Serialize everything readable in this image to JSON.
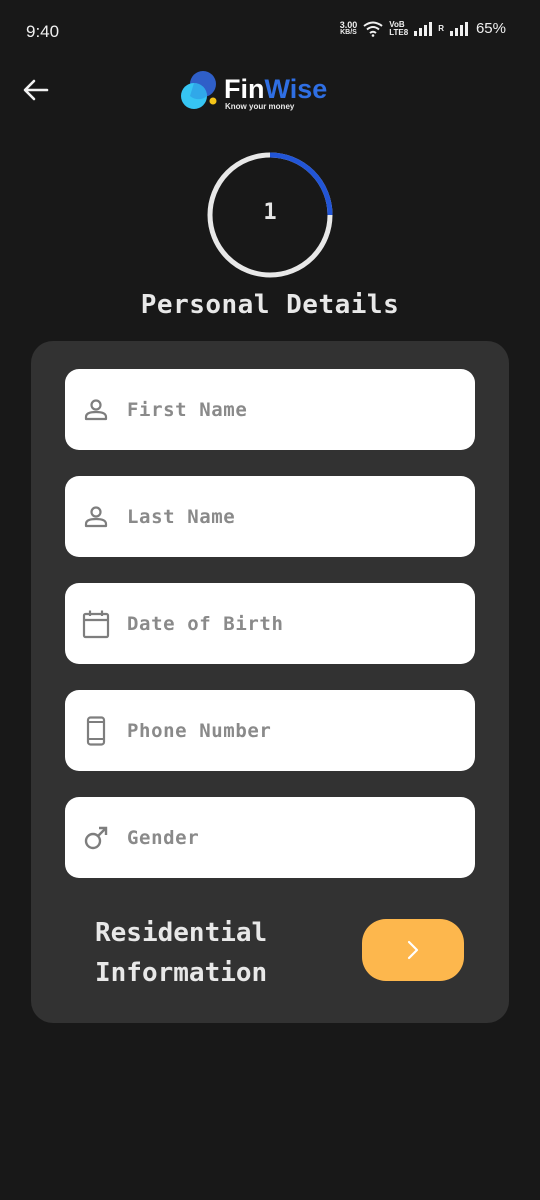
{
  "status_bar": {
    "time": "9:40",
    "net_speed_value": "3.00",
    "net_speed_unit": "KB/S",
    "volte_top": "VoB",
    "volte_bottom": "LTE8",
    "roaming": "R",
    "battery": "65%"
  },
  "header": {
    "back_icon": "arrow-left-icon",
    "logo_name_part1": "Fin",
    "logo_name_part2": "Wise",
    "logo_tagline": "Know your money",
    "logo_colors": {
      "dark_blue": "#2f5fc8",
      "cyan": "#36c5f3",
      "yellow": "#f5c518",
      "wise": "#2f6fe4"
    }
  },
  "progress": {
    "step": "1",
    "fraction": 0.25,
    "track_color": "#e8e8e8",
    "fill_color": "#2255d6"
  },
  "form": {
    "title": "Personal Details",
    "fields": [
      {
        "icon": "person-icon",
        "placeholder": "First Name"
      },
      {
        "icon": "person-icon",
        "placeholder": "Last Name"
      },
      {
        "icon": "calendar-icon",
        "placeholder": "Date of Birth"
      },
      {
        "icon": "phone-icon",
        "placeholder": "Phone Number"
      },
      {
        "icon": "male-icon",
        "placeholder": "Gender"
      }
    ],
    "next_label_line1": "Residential",
    "next_label_line2": "Information",
    "next_button_icon": "chevron-right-icon",
    "next_button_color": "#fdb74d"
  }
}
